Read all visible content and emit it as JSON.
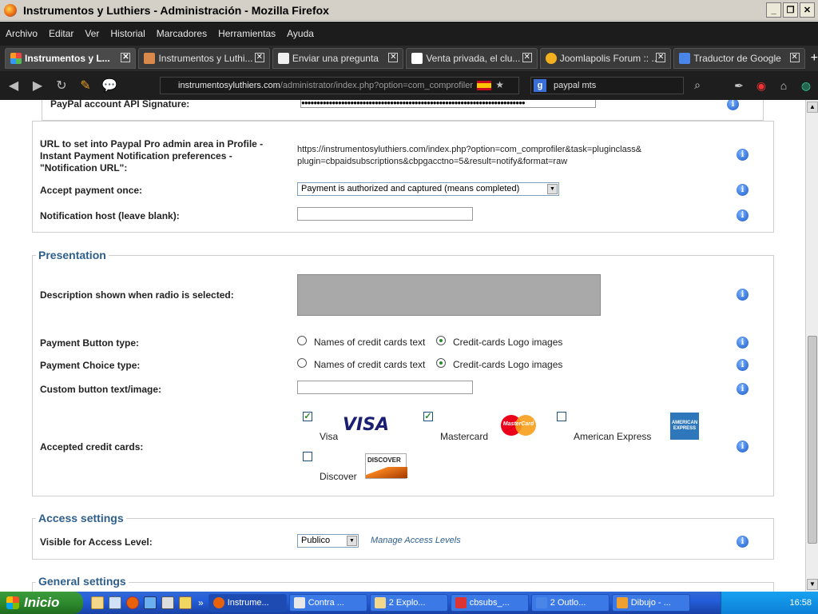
{
  "window": {
    "title": "Instrumentos y Luthiers - Administración - Mozilla Firefox"
  },
  "menu": [
    "Archivo",
    "Editar",
    "Ver",
    "Historial",
    "Marcadores",
    "Herramientas",
    "Ayuda"
  ],
  "tabs": [
    {
      "label": "Instrumentos y L...",
      "active": true
    },
    {
      "label": "Instrumentos y Luthi...",
      "active": false
    },
    {
      "label": "Enviar una pregunta",
      "active": false
    },
    {
      "label": "Venta privada, el clu...",
      "active": false
    },
    {
      "label": "Joomlapolis Forum :: ...",
      "active": false
    },
    {
      "label": "Traductor de Google",
      "active": false
    }
  ],
  "nav": {
    "url_host": "instrumentosyluthiers.com",
    "url_path": "/administrator/index.php?option=com_comprofiler",
    "search_value": "paypal mts"
  },
  "paypal": {
    "api_signature_label": "PayPal account API Signature:",
    "api_signature_value": "●●●●●●●●●●●●●●●●●●●●●●●●●●●●●●●●●●●●●●●●●●●●●●●●●●●●●●●●●●●●●●●●●●●●●●●●●"
  },
  "notify": {
    "url_label_1": "URL to set into Paypal Pro admin area in Profile -",
    "url_label_2": "Instant Payment Notification preferences -",
    "url_label_3": "\"Notification URL\":",
    "url_value_1": "https://instrumentosyluthiers.com/index.php?option=com_comprofiler&task=pluginclass&",
    "url_value_2": "plugin=cbpaidsubscriptions&cbpgacctno=5&result=notify&format=raw",
    "accept_once_label": "Accept payment once:",
    "accept_once_value": "Payment is authorized and captured (means completed)",
    "host_label": "Notification host (leave blank):",
    "host_value": ""
  },
  "presentation": {
    "legend": "Presentation",
    "description_label": "Description shown when radio is selected:",
    "button_type_label": "Payment Button type:",
    "choice_type_label": "Payment Choice type:",
    "option_names": "Names of credit cards text",
    "option_logos": "Credit-cards Logo images",
    "custom_button_label": "Custom button text/image:",
    "custom_button_value": "",
    "accepted_cards_label": "Accepted credit cards:",
    "cards": [
      {
        "name": "Visa",
        "checked": true
      },
      {
        "name": "Mastercard",
        "checked": true
      },
      {
        "name": "American Express",
        "checked": false
      },
      {
        "name": "Discover",
        "checked": false
      }
    ],
    "logo_texts": {
      "visa": "VISA",
      "mastercard": "MasterCard",
      "amex": "AMERICAN EXPRESS",
      "discover": "DISCOVER"
    }
  },
  "access": {
    "legend": "Access settings",
    "visible_label": "Visible for Access Level:",
    "visible_value": "Publico",
    "manage_link": "Manage Access Levels"
  },
  "general": {
    "legend": "General settings"
  },
  "info_glyph": "i",
  "taskbar": {
    "start_label": "Inicio",
    "tasks": [
      "Instrume...",
      "Contra ...",
      "2 Explo...",
      "cbsubs_...",
      "2 Outlo...",
      "Dibujo - ..."
    ],
    "clock": "16:58"
  }
}
